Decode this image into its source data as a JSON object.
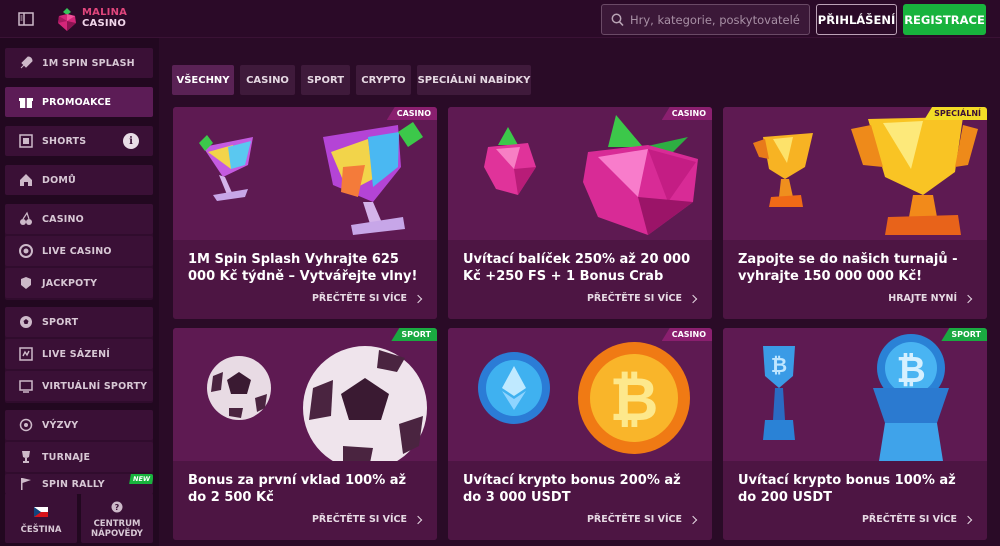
{
  "header": {
    "logo_line1": "MALINA",
    "logo_line2": "CASINO",
    "search_placeholder": "Hry, kategorie, poskytovatelé",
    "login_label": "PŘIHLÁŠENÍ",
    "register_label": "REGISTRACE"
  },
  "sidebar": {
    "items": [
      {
        "label": "1M SPIN SPLASH",
        "icon": "rocket-icon"
      },
      {
        "label": "PROMOAKCE",
        "icon": "gift-icon"
      },
      {
        "label": "SHORTS",
        "icon": "film-icon"
      },
      {
        "label": "DOMŮ",
        "icon": "home-icon"
      },
      {
        "label": "CASINO",
        "icon": "cherries-icon"
      },
      {
        "label": "LIVE CASINO",
        "icon": "chip-icon"
      },
      {
        "label": "JACKPOTY",
        "icon": "crown-icon"
      },
      {
        "label": "SPORT",
        "icon": "ball-icon"
      },
      {
        "label": "LIVE SÁZENÍ",
        "icon": "live-icon"
      },
      {
        "label": "VIRTUÁLNÍ SPORTY",
        "icon": "virtual-icon"
      },
      {
        "label": "VÝZVY",
        "icon": "target-icon"
      },
      {
        "label": "TURNAJE",
        "icon": "trophy-icon"
      },
      {
        "label": "SPIN RALLY",
        "icon": "flag-icon"
      }
    ],
    "new_badge": "NEW",
    "language_label": "ČEŠTINA",
    "help_label_1": "CENTRUM",
    "help_label_2": "NÁPOVĚDY"
  },
  "tabs": [
    {
      "label": "VŠECHNY",
      "active": true
    },
    {
      "label": "CASINO",
      "active": false
    },
    {
      "label": "SPORT",
      "active": false
    },
    {
      "label": "CRYPTO",
      "active": false
    },
    {
      "label": "SPECIÁLNÍ NABÍDKY",
      "active": false
    }
  ],
  "cards": [
    {
      "badge": "CASINO",
      "title": "1M Spin Splash Vyhrajte 625 000 Kč týdně – Vytvářejte vlny!",
      "link": "PŘEČTĚTE SI VÍCE"
    },
    {
      "badge": "CASINO",
      "title": "Uvítací balíček 250% až 20 000 Kč +250 FS + 1 Bonus Crab",
      "link": "PŘEČTĚTE SI VÍCE"
    },
    {
      "badge": "SPECIÁLNÍ",
      "title": "Zapojte se do našich turnajů - vyhrajte 150 000 000 Kč!",
      "link": "HRAJTE NYNÍ"
    },
    {
      "badge": "SPORT",
      "title": "Bonus za první vklad 100% až do 2 500 Kč",
      "link": "PŘEČTĚTE SI VÍCE"
    },
    {
      "badge": "CASINO",
      "title": "Uvítací krypto bonus 200% až do 3 000 USDT",
      "link": "PŘEČTĚTE SI VÍCE"
    },
    {
      "badge": "SPORT",
      "title": "Uvítací krypto bonus 100% až do 200 USDT",
      "link": "PŘEČTĚTE SI VÍCE"
    }
  ],
  "colors": {
    "background": "#2a0b27",
    "card": "#531748",
    "register": "#18b33d",
    "badge_casino": "#8a1f6f",
    "badge_sport": "#1aa941",
    "badge_special": "#f3dc26"
  }
}
